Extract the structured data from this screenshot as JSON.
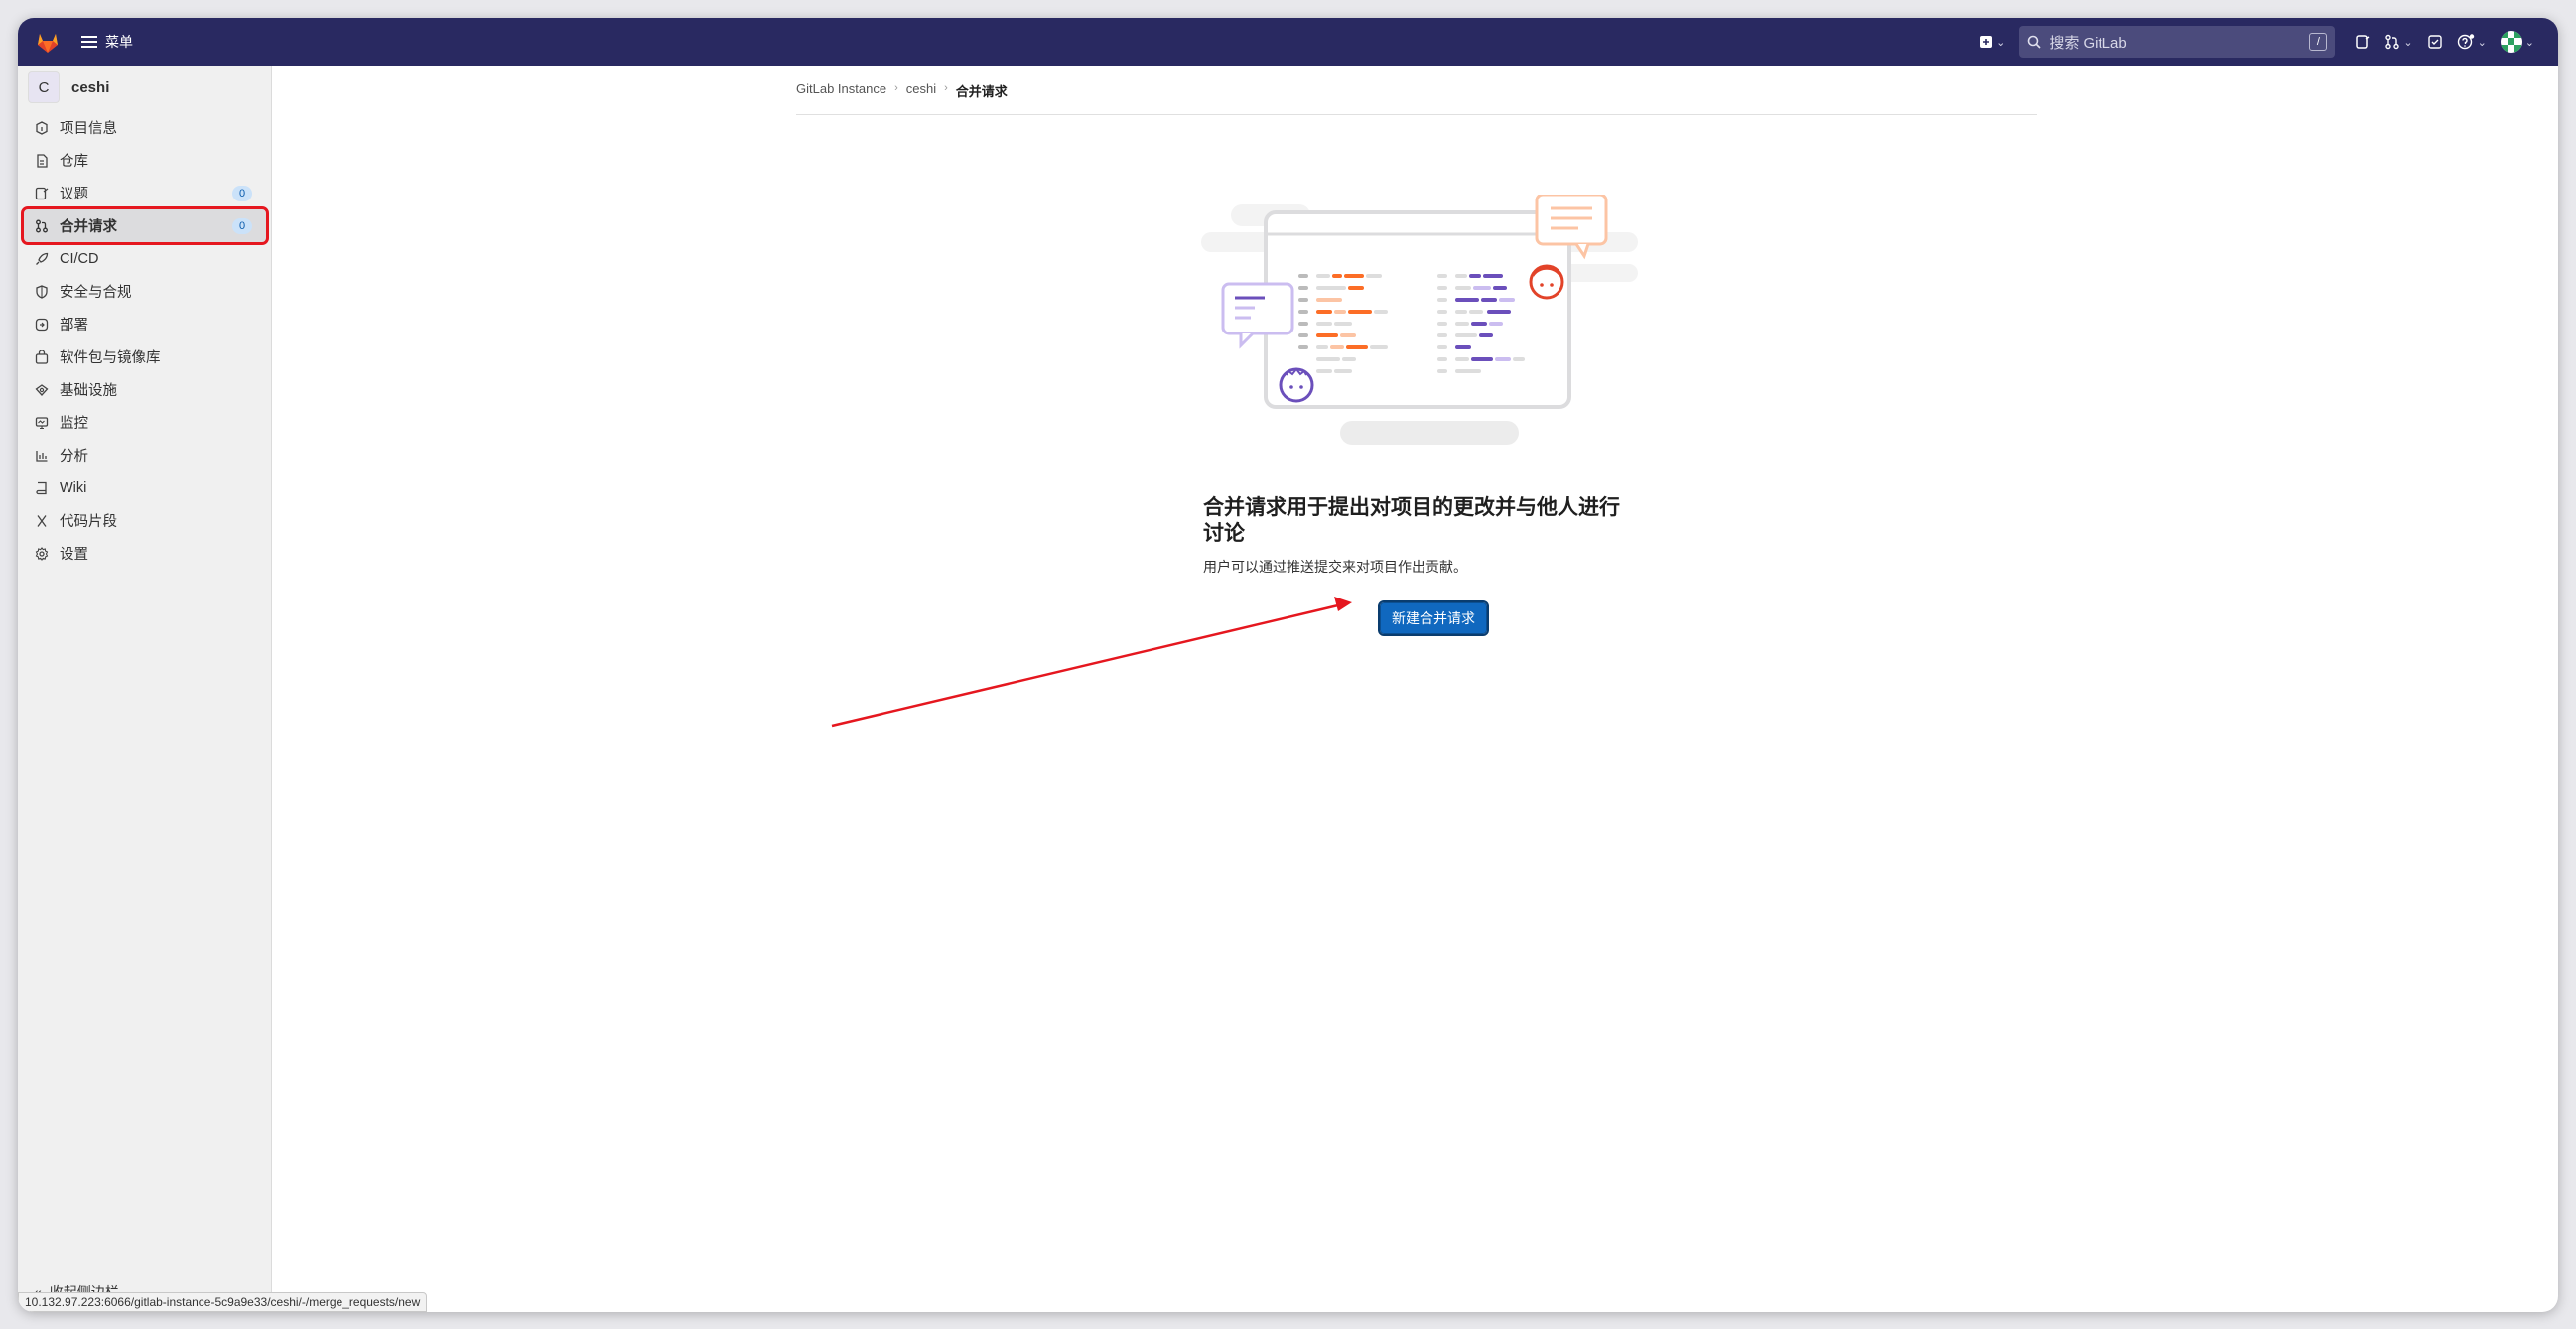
{
  "topbar": {
    "menu_label": "菜单",
    "search_placeholder": "搜索 GitLab",
    "search_shortcut": "/"
  },
  "sidebar": {
    "project_initial": "C",
    "project_name": "ceshi",
    "items": [
      {
        "label": "项目信息",
        "icon": "info-icon"
      },
      {
        "label": "仓库",
        "icon": "document-icon"
      },
      {
        "label": "议题",
        "icon": "issues-icon",
        "badge": "0"
      },
      {
        "label": "合并请求",
        "icon": "merge-request-icon",
        "badge": "0",
        "active": true
      },
      {
        "label": "CI/CD",
        "icon": "rocket-icon"
      },
      {
        "label": "安全与合规",
        "icon": "shield-icon"
      },
      {
        "label": "部署",
        "icon": "deploy-icon"
      },
      {
        "label": "软件包与镜像库",
        "icon": "package-icon"
      },
      {
        "label": "基础设施",
        "icon": "cloud-icon"
      },
      {
        "label": "监控",
        "icon": "monitor-icon"
      },
      {
        "label": "分析",
        "icon": "chart-icon"
      },
      {
        "label": "Wiki",
        "icon": "book-icon"
      },
      {
        "label": "代码片段",
        "icon": "snippet-icon"
      },
      {
        "label": "设置",
        "icon": "gear-icon"
      }
    ],
    "collapse_label": "收起侧边栏"
  },
  "status_url": "10.132.97.223:6066/gitlab-instance-5c9a9e33/ceshi/-/merge_requests/new",
  "breadcrumb": {
    "items": [
      "GitLab Instance",
      "ceshi"
    ],
    "current": "合并请求"
  },
  "empty_state": {
    "title": "合并请求用于提出对项目的更改并与他人进行讨论",
    "description": "用户可以通过推送提交来对项目作出贡献。",
    "button_label": "新建合并请求"
  },
  "colors": {
    "navbar": "#292961",
    "primary": "#1068bf",
    "highlight": "#e5171f",
    "annotation_arrow": "#e5171f"
  }
}
